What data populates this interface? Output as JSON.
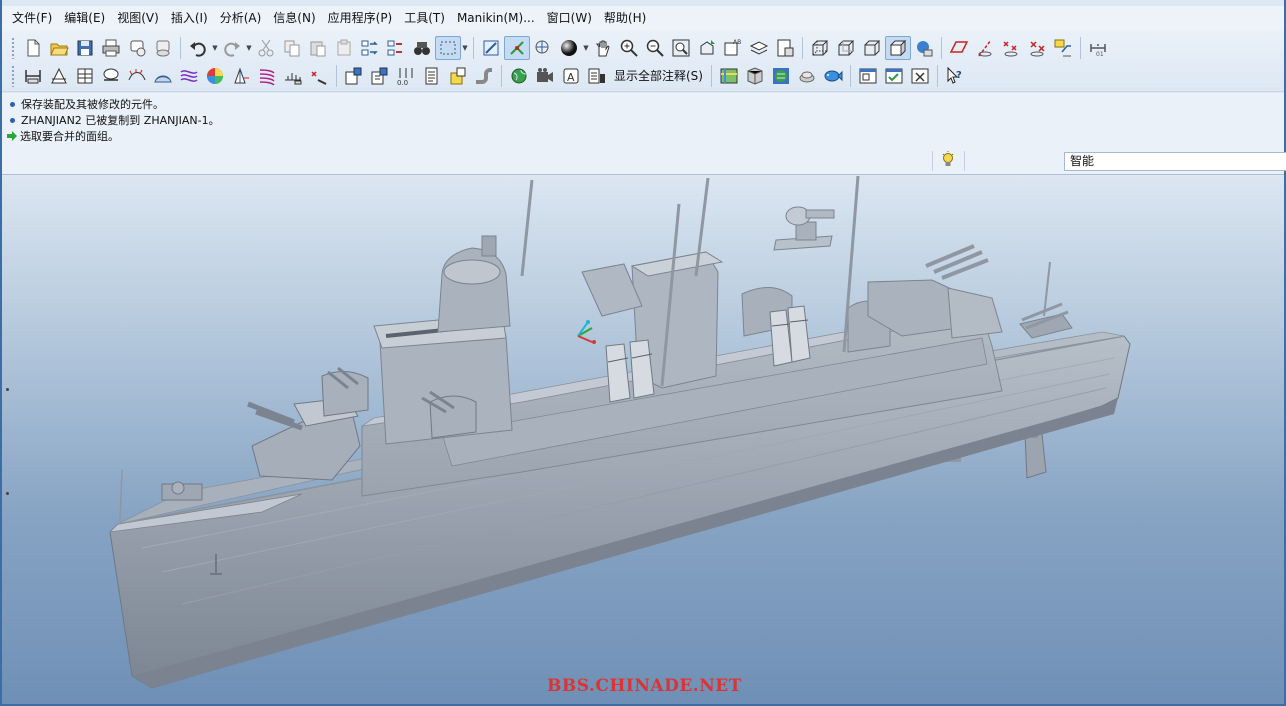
{
  "menu": {
    "items": [
      "文件(F)",
      "编辑(E)",
      "视图(V)",
      "插入(I)",
      "分析(A)",
      "信息(N)",
      "应用程序(P)",
      "工具(T)",
      "Manikin(M)...",
      "窗口(W)",
      "帮助(H)"
    ]
  },
  "toolbar": {
    "show_all_annotations_label": "显示全部注释(S)"
  },
  "messages": {
    "line1": "保存装配及其被修改的元件。",
    "line2": "ZHANJIAN2 已被复制到 ZHANJIAN-1。",
    "line3": "选取要合并的面组。"
  },
  "filter": {
    "value": "智能"
  },
  "graphics": {
    "watermark": "BBS.CHINADE.NET",
    "model_color": "#a4adb8",
    "background_top": "#dbe6f1",
    "background_bottom": "#6f90b6"
  },
  "icons": {
    "row1": [
      "new-file-icon",
      "open-folder-icon",
      "save-icon",
      "print-icon",
      "send-mail-icon",
      "undo-icon",
      "redo-icon",
      "cut-icon",
      "copy-icon",
      "paste-icon",
      "paste-special-icon",
      "regenerate-icon",
      "regen-manager-icon",
      "find-icon",
      "selection-box-icon",
      "repaint-icon",
      "spin-center-icon",
      "orient-mode-icon",
      "shading-icon",
      "pan-icon",
      "zoom-in-icon",
      "zoom-out-icon",
      "refit-icon",
      "reorient-icon",
      "saved-views-icon",
      "layers-icon",
      "view-manager-icon",
      "wireframe-icon",
      "hidden-line-icon",
      "no-hidden-icon",
      "shaded-icon",
      "enhanced-realism-icon",
      "datum-planes-icon",
      "datum-axes-icon",
      "datum-points-icon",
      "coord-systems-icon",
      "annotations-display-icon",
      "model-tree-icon"
    ],
    "row2": [
      "measure-icon",
      "mass-properties-icon",
      "section-icon",
      "curve-analysis-icon",
      "curvature-icon",
      "surface-analysis-icon",
      "reflection-icon",
      "shade-analysis-icon",
      "draft-analysis-icon",
      "slope-icon",
      "dihedral-icon",
      "offset-analysis-icon",
      "component-place-icon",
      "assemble-icon",
      "explode-icon",
      "bom-icon",
      "component-create-icon",
      "pipe-icon",
      "globe-icon",
      "video-icon",
      "annotation-a-icon",
      "display-icon",
      "map-icon",
      "mesh-icon",
      "render-icon",
      "sprocket-icon",
      "fish-icon",
      "window-activate-icon",
      "window-check-icon",
      "window-close-icon",
      "context-help-icon"
    ]
  }
}
